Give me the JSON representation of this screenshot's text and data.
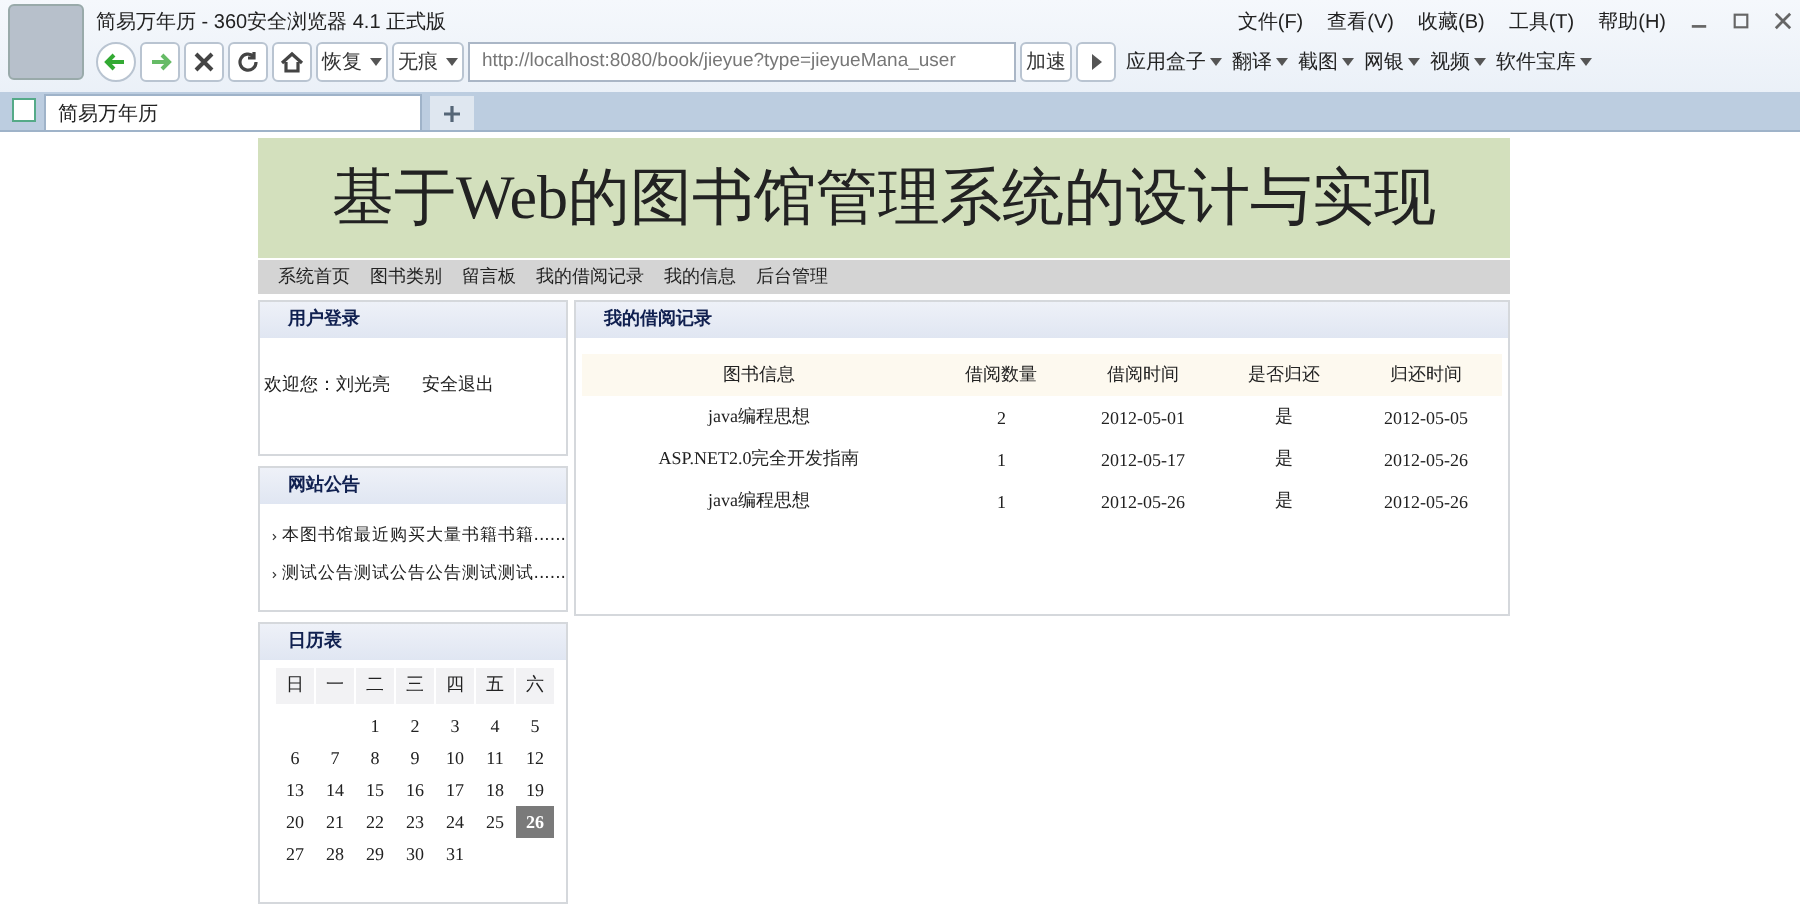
{
  "browser": {
    "title": "简易万年历 - 360安全浏览器 4.1 正式版",
    "menu": [
      "文件(F)",
      "查看(V)",
      "收藏(B)",
      "工具(T)",
      "帮助(H)"
    ],
    "restore": "恢复",
    "incognito": "无痕",
    "address": "http://localhost:8080/book/jieyue?type=jieyueMana_user",
    "speedup": "加速",
    "tools": [
      "应用盒子",
      "翻译",
      "截图",
      "网银",
      "视频",
      "软件宝库"
    ],
    "tab": {
      "title": "简易万年历",
      "selected": true
    }
  },
  "page": {
    "banner_title": "基于Web的图书馆管理系统的设计与实现",
    "nav": [
      "系统首页",
      "图书类别",
      "留言板",
      "我的借阅记录",
      "我的信息",
      "后台管理"
    ],
    "login": {
      "title": "用户登录",
      "welcome": "欢迎您：刘光亮",
      "logout": "安全退出"
    },
    "notices": {
      "title": "网站公告",
      "items": [
        "本图书馆最近购买大量书籍书籍......",
        "测试公告测试公告公告测试测试......"
      ]
    },
    "calendar": {
      "title": "日历表",
      "weekdays": [
        "日",
        "一",
        "二",
        "三",
        "四",
        "五",
        "六"
      ],
      "weeks": [
        {
          "kind": "first",
          "days": [
            {
              "day": "1",
              "selected": false
            },
            {
              "day": "2",
              "selected": false
            },
            {
              "day": "3",
              "selected": false
            },
            {
              "day": "4",
              "selected": false
            },
            {
              "day": "5",
              "selected": false
            }
          ]
        },
        {
          "kind": "full",
          "days": [
            {
              "day": "6",
              "selected": false
            },
            {
              "day": "7",
              "selected": false
            },
            {
              "day": "8",
              "selected": false
            },
            {
              "day": "9",
              "selected": false
            },
            {
              "day": "10",
              "selected": false
            },
            {
              "day": "11",
              "selected": false
            },
            {
              "day": "12",
              "selected": false
            }
          ]
        },
        {
          "kind": "full",
          "days": [
            {
              "day": "13",
              "selected": false
            },
            {
              "day": "14",
              "selected": false
            },
            {
              "day": "15",
              "selected": false
            },
            {
              "day": "16",
              "selected": false
            },
            {
              "day": "17",
              "selected": false
            },
            {
              "day": "18",
              "selected": false
            },
            {
              "day": "19",
              "selected": false
            }
          ]
        },
        {
          "kind": "full",
          "days": [
            {
              "day": "20",
              "selected": false
            },
            {
              "day": "21",
              "selected": false
            },
            {
              "day": "22",
              "selected": false
            },
            {
              "day": "23",
              "selected": false
            },
            {
              "day": "24",
              "selected": false
            },
            {
              "day": "25",
              "selected": false
            },
            {
              "day": "26",
              "selected": true
            }
          ]
        },
        {
          "kind": "last",
          "days": [
            {
              "day": "27",
              "selected": false
            },
            {
              "day": "28",
              "selected": false
            },
            {
              "day": "29",
              "selected": false
            },
            {
              "day": "30",
              "selected": false
            },
            {
              "day": "31",
              "selected": false
            }
          ]
        }
      ]
    },
    "records": {
      "title": "我的借阅记录",
      "columns": [
        "图书信息",
        "借阅数量",
        "借阅时间",
        "是否归还",
        "归还时间"
      ],
      "rows": [
        [
          "java编程思想",
          "2",
          "2012-05-01",
          "是",
          "2012-05-05"
        ],
        [
          "ASP.NET2.0完全开发指南",
          "1",
          "2012-05-17",
          "是",
          "2012-05-26"
        ],
        [
          "java编程思想",
          "1",
          "2012-05-26",
          "是",
          "2012-05-26"
        ]
      ]
    }
  }
}
